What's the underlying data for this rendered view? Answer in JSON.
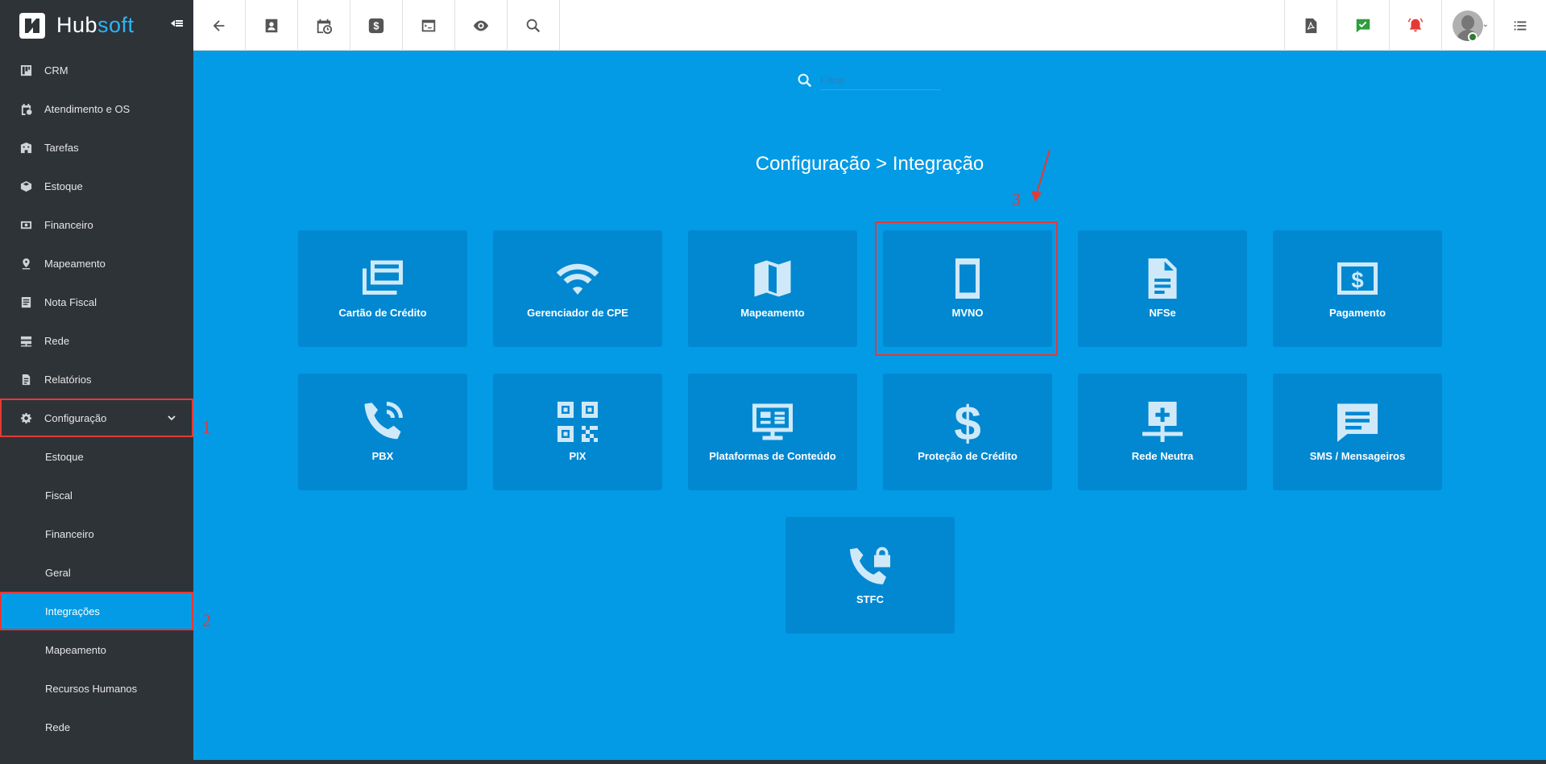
{
  "brand": {
    "name_part1": "Hub",
    "name_part2": "soft"
  },
  "sidebar": {
    "items": [
      {
        "label": "CRM",
        "icon": "kanban-icon"
      },
      {
        "label": "Atendimento e OS",
        "icon": "calendar-clock-icon"
      },
      {
        "label": "Tarefas",
        "icon": "building-icon"
      },
      {
        "label": "Estoque",
        "icon": "box-icon"
      },
      {
        "label": "Financeiro",
        "icon": "money-icon"
      },
      {
        "label": "Mapeamento",
        "icon": "map-pin-icon"
      },
      {
        "label": "Nota Fiscal",
        "icon": "document-icon"
      },
      {
        "label": "Rede",
        "icon": "server-icon"
      },
      {
        "label": "Relatórios",
        "icon": "report-icon"
      }
    ],
    "expanded": {
      "label": "Configuração",
      "icon": "gear-icon"
    },
    "sub_items": [
      {
        "label": "Estoque"
      },
      {
        "label": "Fiscal"
      },
      {
        "label": "Financeiro"
      },
      {
        "label": "Geral"
      },
      {
        "label": "Integrações",
        "active": true
      },
      {
        "label": "Mapeamento"
      },
      {
        "label": "Recursos Humanos"
      },
      {
        "label": "Rede"
      }
    ]
  },
  "topbar": {
    "left_icons": [
      "back-arrow-icon",
      "contact-card-icon",
      "calendar-clock-icon",
      "dollar-icon",
      "terminal-icon",
      "eye-icon",
      "search-icon"
    ],
    "right_icons": [
      "pdf-icon",
      "chat-check-icon",
      "alarm-bell-icon",
      "user-avatar"
    ]
  },
  "filter": {
    "placeholder": "Filtrar"
  },
  "page": {
    "title": "Configuração > Integração"
  },
  "tiles": [
    {
      "label": "Cartão de Crédito",
      "icon": "credit-card-icon"
    },
    {
      "label": "Gerenciador de CPE",
      "icon": "wifi-icon"
    },
    {
      "label": "Mapeamento",
      "icon": "map-icon"
    },
    {
      "label": "MVNO",
      "icon": "mobile-icon"
    },
    {
      "label": "NFSe",
      "icon": "document-icon"
    },
    {
      "label": "Pagamento",
      "icon": "money-icon"
    },
    {
      "label": "PBX",
      "icon": "phone-icon"
    },
    {
      "label": "PIX",
      "icon": "qrcode-icon"
    },
    {
      "label": "Plataformas de Conteúdo",
      "icon": "monitor-icon"
    },
    {
      "label": "Proteção de Crédito",
      "icon": "dollar-icon"
    },
    {
      "label": "Rede Neutra",
      "icon": "network-add-icon"
    },
    {
      "label": "SMS / Mensageiros",
      "icon": "message-icon"
    },
    {
      "label": "STFC",
      "icon": "phone-lock-icon"
    }
  ],
  "annotations": {
    "one": "1",
    "two": "2",
    "three": "3"
  },
  "colors": {
    "accent": "#039be5",
    "sidebar": "#2e3338",
    "tile": "#0288d1",
    "highlight": "#e53935"
  }
}
